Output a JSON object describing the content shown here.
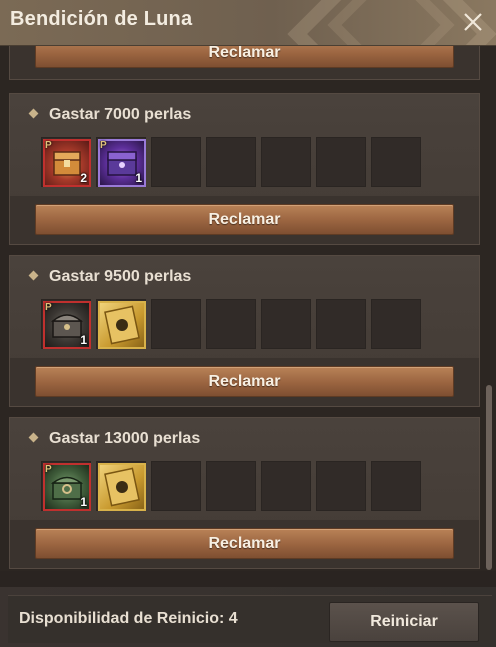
{
  "window": {
    "title": "Bendición de Luna"
  },
  "icons": {
    "close": "close-icon"
  },
  "top_partial": {
    "claim_label": "Reclamar"
  },
  "cards": [
    {
      "title": "Gastar 7000 perlas",
      "claim_label": "Reclamar",
      "items": [
        {
          "icon": "red-chest-icon",
          "qty": "2",
          "badge": "P"
        },
        {
          "icon": "purple-chest-icon",
          "qty": "1",
          "badge": "P"
        }
      ]
    },
    {
      "title": "Gastar 9500 perlas",
      "claim_label": "Reclamar",
      "items": [
        {
          "icon": "armor-chest-icon",
          "qty": "1",
          "badge": "P"
        },
        {
          "icon": "gold-ticket-icon",
          "qty": "",
          "badge": ""
        }
      ]
    },
    {
      "title": "Gastar 13000 perlas",
      "claim_label": "Reclamar",
      "items": [
        {
          "icon": "green-chest-icon",
          "qty": "1",
          "badge": "P"
        },
        {
          "icon": "gold-ticket-icon",
          "qty": "",
          "badge": ""
        }
      ]
    }
  ],
  "footer": {
    "reset_availability": "Disponibilidad de Reinicio: 4",
    "reset_button": "Reiniciar"
  },
  "colors": {
    "claim_button": "#9a6440",
    "item_border_red": "#c0302e",
    "item_border_gold": "#d8b24a",
    "item_border_purple": "#9a7ad8"
  }
}
